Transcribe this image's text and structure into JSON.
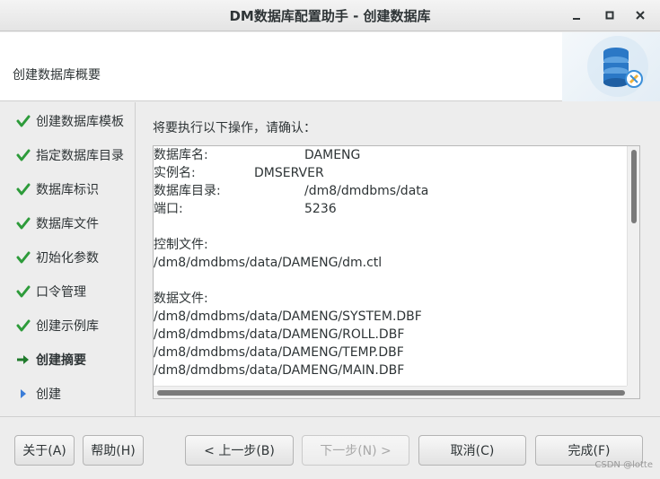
{
  "window": {
    "title": "DM数据库配置助手 - 创建数据库",
    "minimize_icon": "minimize-icon",
    "maximize_icon": "maximize-icon",
    "close_icon": "close-icon"
  },
  "header": {
    "subtitle": "创建数据库概要",
    "logo_icon": "database-settings-icon"
  },
  "sidebar": {
    "steps": [
      {
        "label": "创建数据库模板",
        "status": "done",
        "icon": "checkmark-icon"
      },
      {
        "label": "指定数据库目录",
        "status": "done",
        "icon": "checkmark-icon"
      },
      {
        "label": "数据库标识",
        "status": "done",
        "icon": "checkmark-icon"
      },
      {
        "label": "数据库文件",
        "status": "done",
        "icon": "checkmark-icon"
      },
      {
        "label": "初始化参数",
        "status": "done",
        "icon": "checkmark-icon"
      },
      {
        "label": "口令管理",
        "status": "done",
        "icon": "checkmark-icon"
      },
      {
        "label": "创建示例库",
        "status": "done",
        "icon": "checkmark-icon"
      },
      {
        "label": "创建摘要",
        "status": "current",
        "icon": "arrow-right-icon"
      },
      {
        "label": "创建",
        "status": "pending",
        "icon": "triangle-right-icon"
      }
    ]
  },
  "main": {
    "prompt": "将要执行以下操作，请确认：",
    "summary": {
      "db_name_label": "数据库名:",
      "db_name_value": "DAMENG",
      "instance_label": "实例名:",
      "instance_value": "DMSERVER",
      "db_dir_label": "数据库目录:",
      "db_dir_value": "/dm8/dmdbms/data",
      "port_label": "端口:",
      "port_value": "5236",
      "control_file_label": "控制文件:",
      "control_file_value": "/dm8/dmdbms/data/DAMENG/dm.ctl",
      "data_files_label": "数据文件:",
      "data_files": [
        "/dm8/dmdbms/data/DAMENG/SYSTEM.DBF",
        "/dm8/dmdbms/data/DAMENG/ROLL.DBF",
        "/dm8/dmdbms/data/DAMENG/TEMP.DBF",
        "/dm8/dmdbms/data/DAMENG/MAIN.DBF"
      ]
    }
  },
  "footer": {
    "about_label": "关于(A)",
    "help_label": "帮助(H)",
    "back_label": "< 上一步(B)",
    "next_label": "下一步(N) >",
    "cancel_label": "取消(C)",
    "finish_label": "完成(F)",
    "watermark": "CSDN @lotte"
  },
  "colors": {
    "check_green": "#2d9b3a",
    "arrow_green": "#1f7a2b",
    "triangle_blue": "#3b7dd8"
  }
}
